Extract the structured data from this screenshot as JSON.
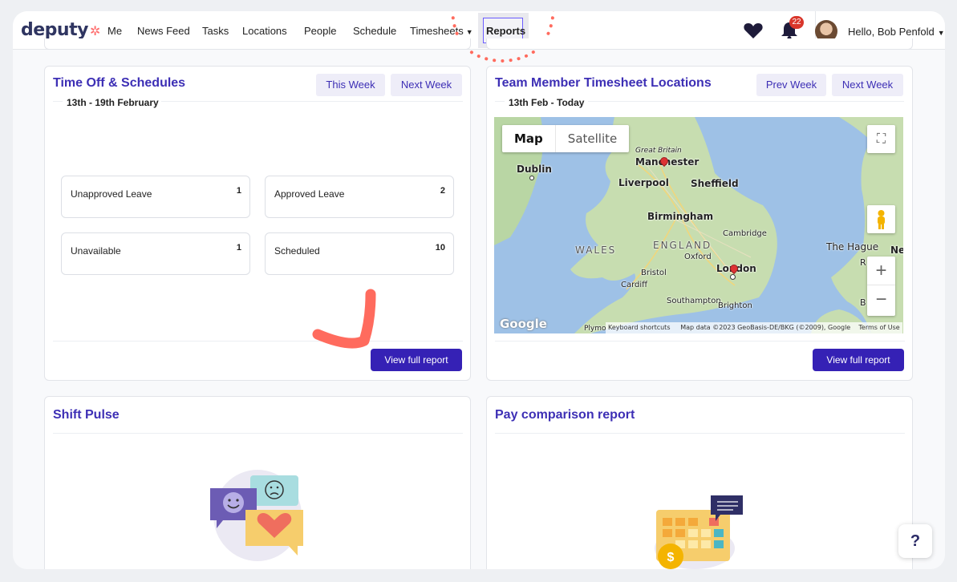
{
  "app": {
    "logo_text": "deputy"
  },
  "nav": {
    "items": [
      {
        "label": "Me"
      },
      {
        "label": "News Feed"
      },
      {
        "label": "Tasks"
      },
      {
        "label": "Locations"
      },
      {
        "label": "People"
      },
      {
        "label": "Schedule"
      },
      {
        "label": "Timesheets"
      },
      {
        "label": "Reports"
      }
    ],
    "notifications_count": "22",
    "greeting": "Hello, Bob Penfold",
    "icons": [
      "heart-icon",
      "bell-icon",
      "chevron-down-icon"
    ]
  },
  "time_off": {
    "title": "Time Off & Schedules",
    "this_week_label": "This Week",
    "next_week_label": "Next Week",
    "date_range": "13th - 19th February",
    "cards": [
      {
        "label": "Unapproved Leave",
        "count": "1"
      },
      {
        "label": "Approved Leave",
        "count": "2"
      },
      {
        "label": "Unavailable",
        "count": "1"
      },
      {
        "label": "Scheduled",
        "count": "10"
      }
    ],
    "view_report_label": "View full report"
  },
  "timesheet_locations": {
    "title": "Team Member Timesheet Locations",
    "prev_week_label": "Prev Week",
    "next_week_label": "Next Week",
    "date_range": "13th Feb - Today",
    "map": {
      "map_tab": "Map",
      "satellite_tab": "Satellite",
      "labels": {
        "great_britain": "Great Britain",
        "manchester": "Manchester",
        "dublin": "Dublin",
        "liverpool": "Liverpool",
        "sheffield": "Sheffield",
        "birmingham": "Birmingham",
        "england": "ENGLAND",
        "wales": "WALES",
        "cambridge": "Cambridge",
        "oxford": "Oxford",
        "london": "London",
        "bristol": "Bristol",
        "cardiff": "Cardiff",
        "southampton": "Southampton",
        "brighton": "Brighton",
        "plymouth": "Plymo",
        "the_hague": "The Hague",
        "ne": "Ne",
        "r": "R",
        "b": "B"
      },
      "google_logo": "Google",
      "keyboard_shortcuts": "Keyboard shortcuts",
      "map_data": "Map data ©2023 GeoBasis-DE/BKG (©2009), Google",
      "terms": "Terms of Use",
      "zoom_in": "+",
      "zoom_out": "−"
    },
    "view_report_label": "View full report"
  },
  "shift_pulse": {
    "title": "Shift Pulse"
  },
  "pay_comparison": {
    "title": "Pay comparison report"
  },
  "help": {
    "label": "?"
  },
  "colors": {
    "brand": "#3521b5",
    "title": "#3d2fb5",
    "annotation": "#ff6b5e"
  }
}
